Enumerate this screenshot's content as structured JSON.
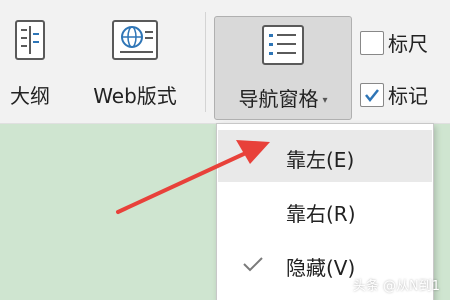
{
  "ribbon": {
    "outline_label": "大纲",
    "web_label": "Web版式",
    "nav_pane_label": "导航窗格",
    "ruler_label": "标尺",
    "ruler_checked": false,
    "mark_label": "标记",
    "mark_checked": true
  },
  "nav_menu": {
    "items": [
      {
        "label": "靠左(E)",
        "highlighted": true,
        "checked": false
      },
      {
        "label": "靠右(R)",
        "highlighted": false,
        "checked": false
      },
      {
        "label": "隐藏(V)",
        "highlighted": false,
        "checked": true
      }
    ]
  },
  "annotation": {
    "arrow_color": "#e8413a"
  },
  "watermark": {
    "text": "头条 @从N到1"
  },
  "colors": {
    "ribbon_bg": "#f2f2f2",
    "document_bg": "#cfe5d0",
    "icon_blue": "#2e75b6",
    "menu_highlight": "#e9e9e9"
  }
}
